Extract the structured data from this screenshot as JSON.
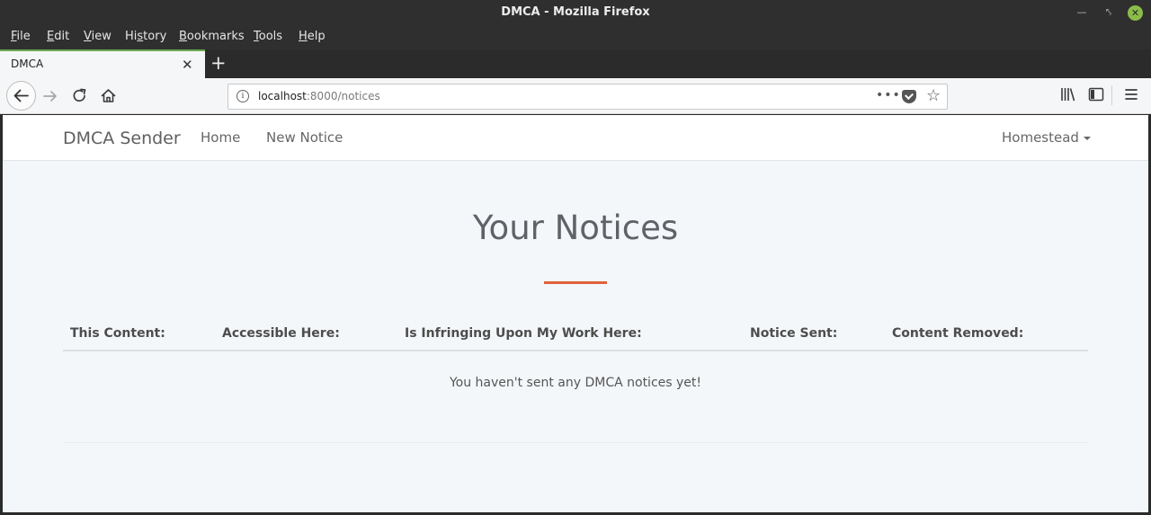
{
  "window": {
    "title": "DMCA - Mozilla Firefox"
  },
  "menubar": {
    "items": [
      {
        "ul": "F",
        "rest": "ile"
      },
      {
        "ul": "E",
        "rest": "dit"
      },
      {
        "ul": "V",
        "rest": "iew"
      },
      {
        "pre": "Hi",
        "ul": "s",
        "rest": "tory"
      },
      {
        "ul": "B",
        "rest": "ookmarks"
      },
      {
        "ul": "T",
        "rest": "ools"
      },
      {
        "ul": "H",
        "rest": "elp"
      }
    ]
  },
  "tabs": [
    {
      "label": "DMCA"
    }
  ],
  "urlbar": {
    "host": "localhost",
    "path": ":8000/notices"
  },
  "site": {
    "brand": "DMCA Sender",
    "nav": {
      "home": "Home",
      "new_notice": "New Notice"
    },
    "user": "Homestead"
  },
  "page": {
    "title": "Your Notices",
    "columns": [
      "This Content:",
      "Accessible Here:",
      "Is Infringing Upon My Work Here:",
      "Notice Sent:",
      "Content Removed:"
    ],
    "empty_message": "You haven't sent any DMCA notices yet!"
  },
  "colors": {
    "accent_rule": "#e0613f",
    "window_close": "#8bbc4a",
    "tab_indicator": "#6aa84f"
  },
  "icons": [
    "back-icon",
    "forward-icon",
    "reload-icon",
    "home-icon",
    "info-icon",
    "page-actions-icon",
    "pocket-icon",
    "bookmark-star-icon",
    "library-icon",
    "sidebar-icon",
    "hamburger-menu-icon"
  ]
}
